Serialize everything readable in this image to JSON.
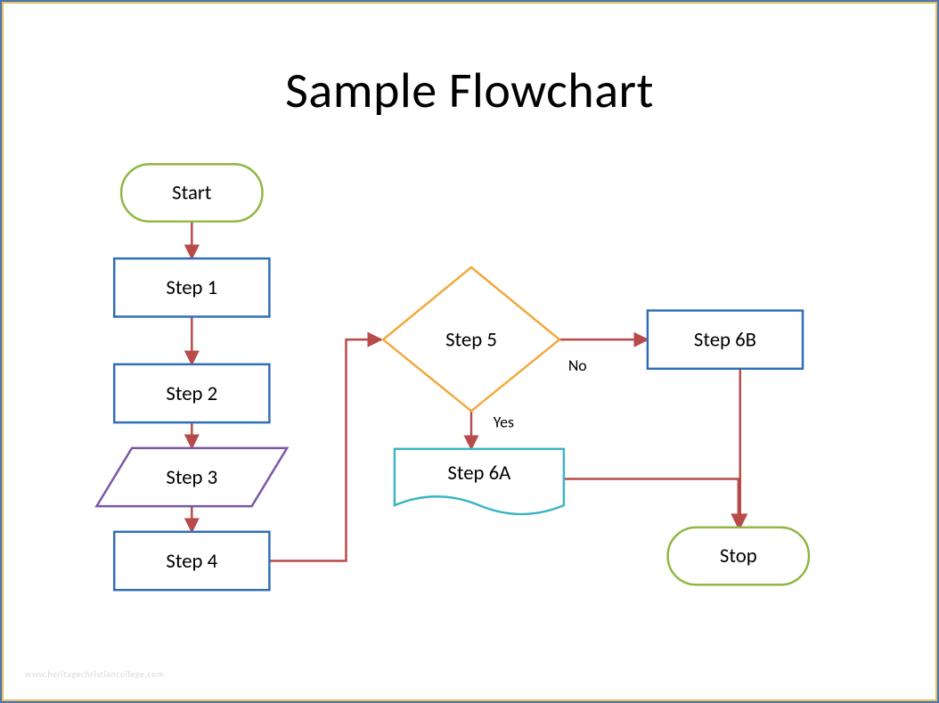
{
  "title": "Sample Flowchart",
  "nodes": {
    "start": {
      "label": "Start"
    },
    "step1": {
      "label": "Step 1"
    },
    "step2": {
      "label": "Step 2"
    },
    "step3": {
      "label": "Step 3"
    },
    "step4": {
      "label": "Step 4"
    },
    "step5": {
      "label": "Step 5"
    },
    "step6a": {
      "label": "Step 6A"
    },
    "step6b": {
      "label": "Step 6B"
    },
    "stop": {
      "label": "Stop"
    }
  },
  "edge_labels": {
    "no": "No",
    "yes": "Yes"
  },
  "colors": {
    "green": "#8fb741",
    "blue": "#2f6eb5",
    "purple": "#7a57a5",
    "orange": "#f2a93c",
    "teal": "#3cb4c5",
    "arrow": "#b84a4a"
  },
  "watermark": "www.heritagechristiancollege.com"
}
